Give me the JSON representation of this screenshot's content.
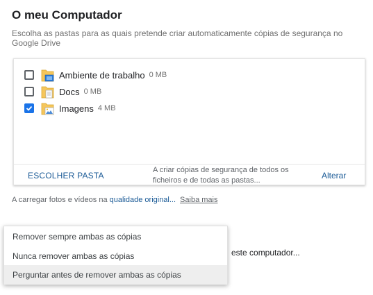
{
  "page": {
    "title": "O meu Computador",
    "subtitle": "Escolha as pastas para as quais pretende criar automaticamente cópias de segurança no Google Drive"
  },
  "folders": [
    {
      "name": "Ambiente de trabalho",
      "size": "0 MB",
      "checked": false,
      "icon": "desktop-folder-icon"
    },
    {
      "name": "Docs",
      "size": "0 MB",
      "checked": false,
      "icon": "documents-folder-icon"
    },
    {
      "name": "Imagens",
      "size": "4 MB",
      "checked": true,
      "icon": "pictures-folder-icon"
    }
  ],
  "card_footer": {
    "choose_label": "ESCOLHER PASTA",
    "status_line1": "A criar cópias de segurança de todos os",
    "status_line2": "ficheiros e de todas as pastas...",
    "change_label": "Alterar"
  },
  "upload": {
    "prefix": "A carregar fotos e vídeos na ",
    "quality_link": "qualidade original...",
    "learn_more": "Saiba mais"
  },
  "behind_text": "este computador...",
  "dropdown": {
    "options": [
      "Remover sempre ambas as cópias",
      "Nunca remover ambas as cópias",
      "Perguntar antes de remover ambas as cópias"
    ],
    "highlighted_index": 2
  },
  "colors": {
    "accent": "#1a73e8",
    "link": "#1a5a96",
    "folder": "#f5c65b"
  }
}
